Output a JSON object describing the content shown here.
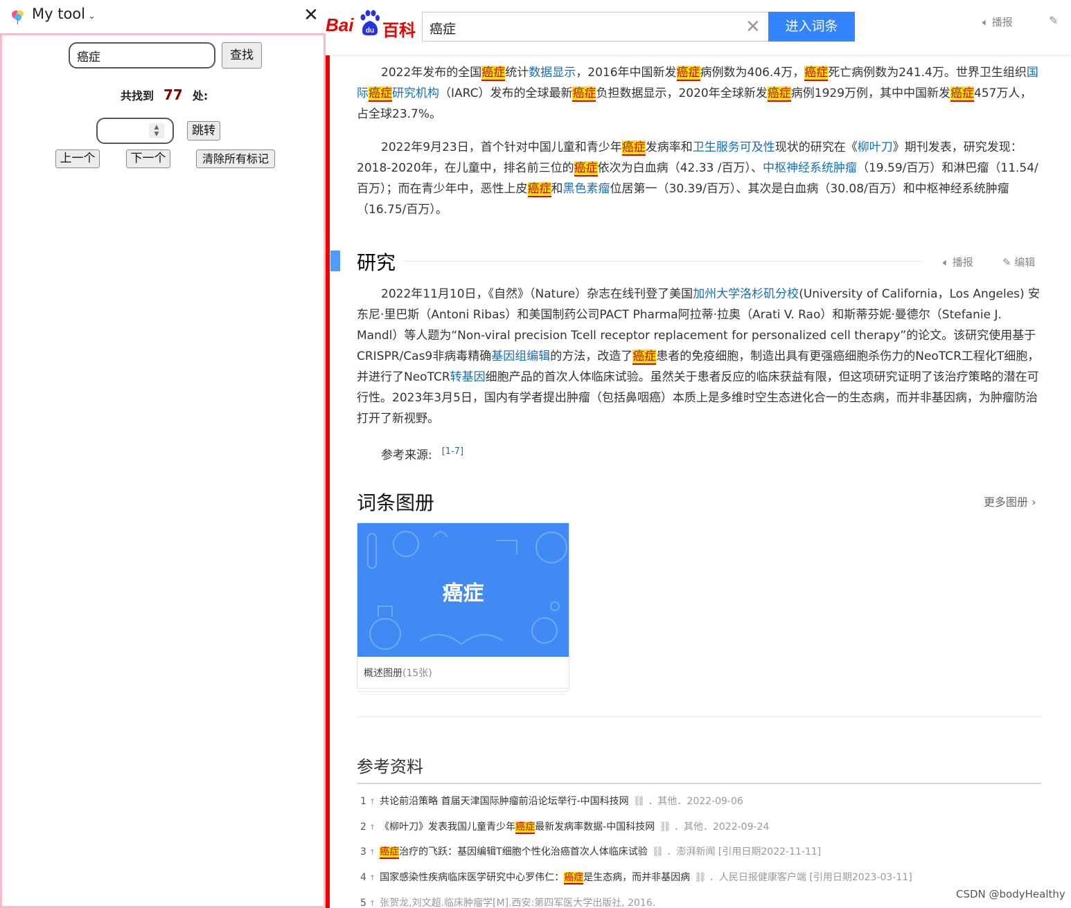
{
  "extension": {
    "title": "My tool",
    "chevron": "⌄",
    "close": "✕",
    "search_value": "癌症",
    "find_label": "查找",
    "found_prefix": "共找到",
    "found_count": "77",
    "found_suffix": "处:",
    "jump_label": "跳转",
    "prev_label": "上一个",
    "next_label": "下一个",
    "clear_label": "清除所有标记"
  },
  "baike": {
    "logo_bai": "Bai",
    "logo_du": "du",
    "logo_baike": "百科",
    "keyword": "癌症",
    "enter_label": "进入词条",
    "speak_label": "播报",
    "edit_label": "编辑",
    "highlight_term": "癌症",
    "para1": {
      "t1": "2022年发布的全国",
      "t2": "统计",
      "l1": "数据显示",
      "t3": "，2016年中国新发",
      "t4": "病例数为406.4万，",
      "t5": "死亡病例数为241.4万。世界卫生组织",
      "l2": "国际",
      "l3": "研究机构",
      "t6": "（IARC）发布的全球最新",
      "t7": "负担数据显示，2020年全球新发",
      "t8": "病例1929万例，其中中国新发",
      "t9": "457万人，占全球23.7%。"
    },
    "para2": {
      "t1": "2022年9月23日，首个针对中国儿童和青少年",
      "t2": "发病率和",
      "l1": "卫生服务可及性",
      "t3": "现状的研究在《",
      "l2": "柳叶刀",
      "t4": "》期刊发表，研究发现：2018-2020年，在儿童中，排名前三位的",
      "t5": "依次为白血病（42.33 /百万）、",
      "l3": "中枢神经系统肿瘤",
      "t6": "（19.59/百万）和淋巴瘤（11.54/百万）；而在青少年中，恶性上皮",
      "t7": "和",
      "l4": "黑色素瘤",
      "t8": "位居第一（30.39/百万）、其次是白血病（30.08/百万）和中枢神经系统肿瘤（16.75/百万）。"
    },
    "section_title": "研究",
    "para3": {
      "t1": "2022年11月10日，《自然》（Nature）杂志在线刊登了美国",
      "l1": "加州大学洛杉矶分校",
      "t2": "(University of California，Los Angeles) 安东尼·里巴斯（Antoni Ribas）和美国制药公司PACT Pharma阿拉蒂·拉奥（Arati V. Rao）和斯蒂芬妮·曼德尔（Stefanie J. Mandl）等人题为“Non-viral precision Tcell receptor replacement for personalized cell therapy”的论文。该研究使用基于CRISPR/Cas9非病毒精确",
      "l2": "基因组编辑",
      "t3": "的方法，改造了",
      "t4": "患者的免疫细胞，制造出具有更强癌细胞杀伤力的NeoTCR工程化T细胞，并进行了NeoTCR",
      "l3": "转基因",
      "t5": "细胞产品的首次人体临床试验。虽然关于患者反应的临床获益有限，但这项研究证明了该治疗策略的潜在可行性。2023年3月5日，国内有学者提出肿瘤（包括鼻咽癌）本质上是多维时空生态进化合一的生态病，而并非基因病，为肿瘤防治打开了新视野。"
    },
    "ref_source_label": "参考来源:",
    "ref_source_sup": "[1-7]",
    "album_title": "词条图册",
    "album_more": "更多图册",
    "album_image_text": "癌症",
    "album_caption": "概述图册",
    "album_count": "(15张)",
    "refs_title": "参考资料",
    "refs": [
      {
        "num": "1",
        "pre": "共论前沿策略 首届天津国际肿瘤前沿论坛举行-中国科技网",
        "hl": "",
        "post": "",
        "meta": "．其他．2022-09-06"
      },
      {
        "num": "2",
        "pre": "《柳叶刀》发表我国儿童青少年",
        "hl": "癌症",
        "post": "最新发病率数据-中国科技网",
        "meta": "．其他．2022-09-24"
      },
      {
        "num": "3",
        "pre": "",
        "hl": "癌症",
        "post": "治疗的飞跃：基因编辑T细胞个性化治癌首次人体临床试验",
        "meta": "．澎湃新闻 [引用日期2022-11-11]"
      },
      {
        "num": "4",
        "pre": "国家感染性疾病临床医学研究中心罗伟仁：",
        "hl": "癌症",
        "post": "是生态病，而并非基因病",
        "meta": "．人民日报健康客户端 [引用日期2023-03-11]"
      },
      {
        "num": "5",
        "pre": "张贺龙,刘文超.临床肿瘤学[M].西安:第四军医大学出版社, 2016.",
        "hl": "",
        "post": "",
        "meta": ""
      }
    ],
    "up_arrow": "↑",
    "chain_icon": "🔗"
  },
  "watermark": "CSDN @bodyHealthy",
  "colors": {
    "accent": "#3385ff",
    "brand_red": "#e10601",
    "highlight": "#ffe100",
    "link": "#136ec2",
    "panel_border": "#f6bcc8"
  }
}
